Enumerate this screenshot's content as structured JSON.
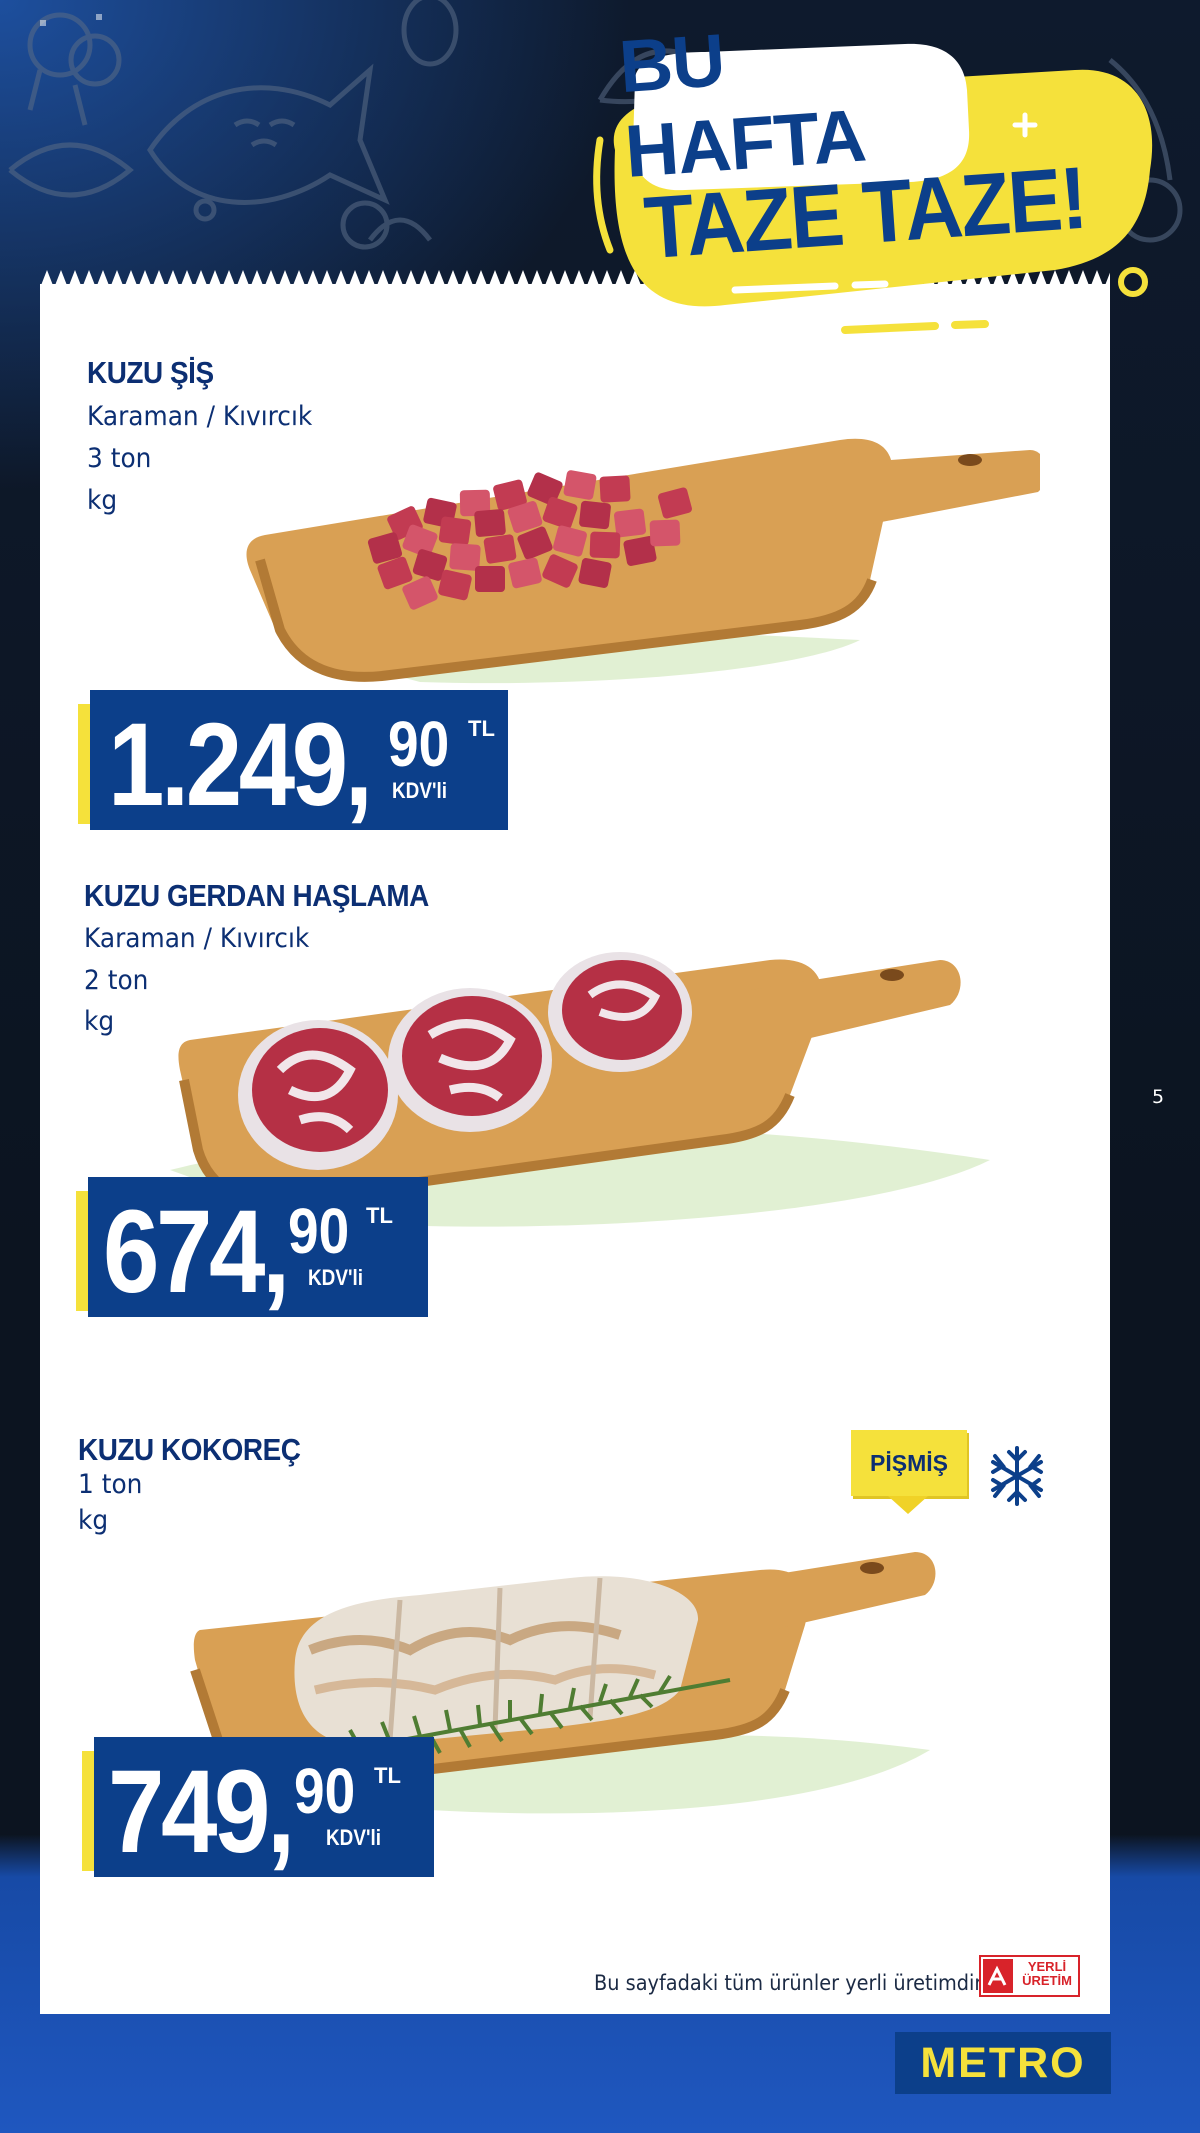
{
  "page": {
    "number": "5"
  },
  "header": {
    "line1": "BU HAFTA",
    "line2": "TAZE TAZE!"
  },
  "products": [
    {
      "name": "KUZU ŞİŞ",
      "details": [
        "Karaman / Kıvırcık",
        "3 ton",
        "kg"
      ],
      "price": {
        "main": "1.249,",
        "decimals": "90",
        "currency": "TL",
        "tax": "KDV'li"
      },
      "image": "diced-lamb-on-cutting-board"
    },
    {
      "name": "KUZU GERDAN HAŞLAMA",
      "details": [
        "Karaman / Kıvırcık",
        "2 ton",
        "kg"
      ],
      "price": {
        "main": "674,",
        "decimals": "90",
        "currency": "TL",
        "tax": "KDV'li"
      },
      "image": "lamb-neck-slices-on-cutting-board"
    },
    {
      "name": "KUZU KOKOREÇ",
      "details": [
        "1 ton",
        "kg"
      ],
      "badge": "PİŞMİŞ",
      "badge_icon": "snowflake-icon",
      "price": {
        "main": "749,",
        "decimals": "90",
        "currency": "TL",
        "tax": "KDV'li"
      },
      "image": "kokorec-on-cutting-board"
    }
  ],
  "footer": {
    "note": "Bu sayfadaki tüm ürünler yerli üretimdir.",
    "badge_line1": "YERLİ",
    "badge_line2": "ÜRETİM",
    "brand": "METRO"
  },
  "colors": {
    "brand_blue": "#0c3f8a",
    "accent_yellow": "#f5e13b",
    "background_dark": "#0d1522"
  }
}
